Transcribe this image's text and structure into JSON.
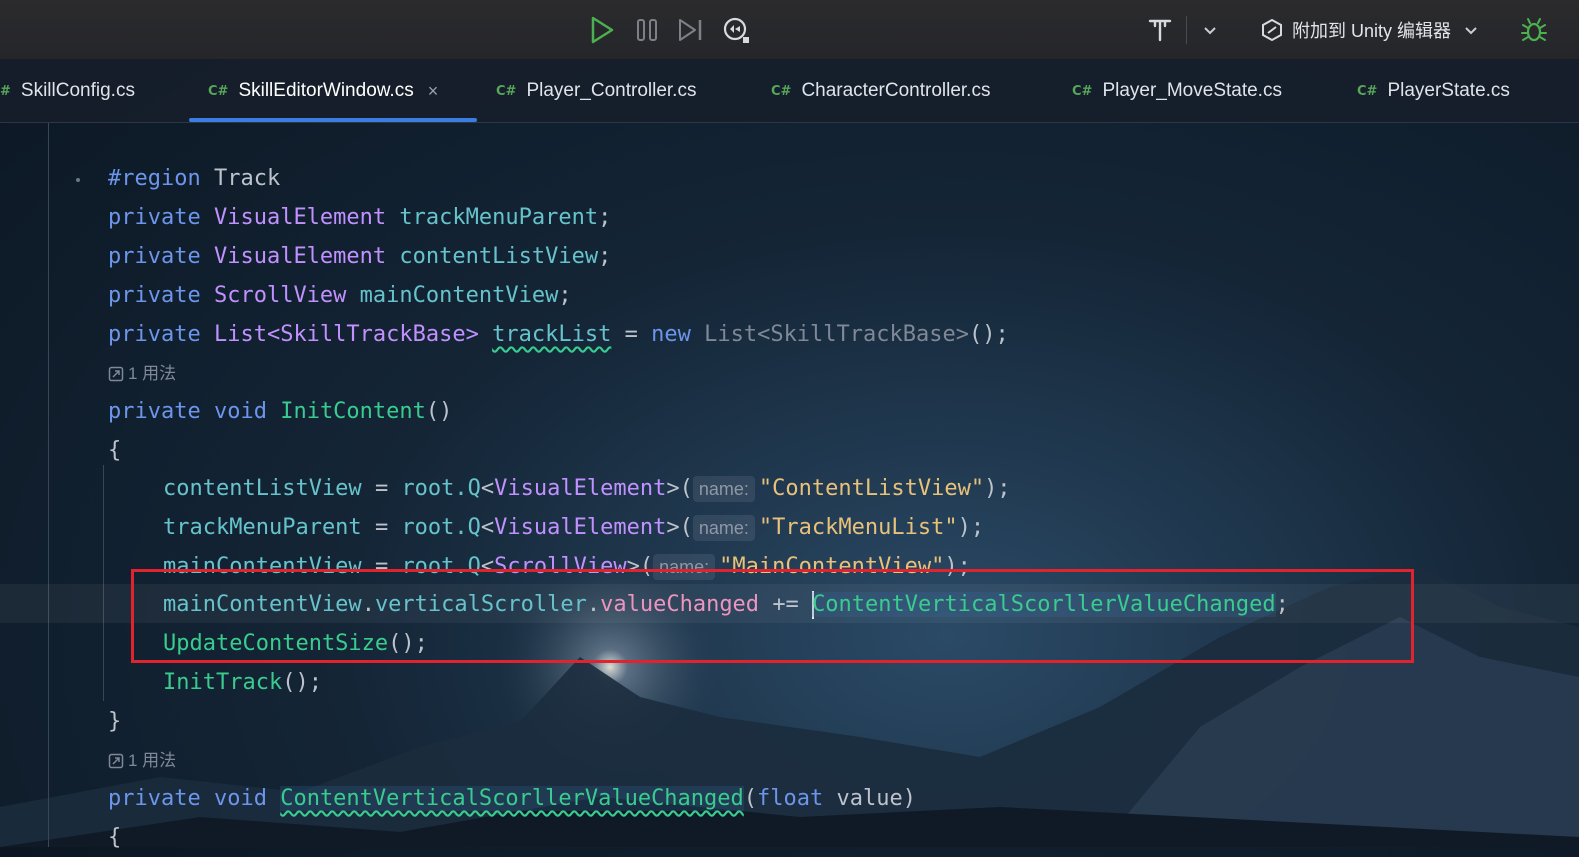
{
  "toolbar": {
    "attach_label": "附加到 Unity 编辑器",
    "colors": {
      "run": "#4caf50",
      "bug": "#4caf50"
    }
  },
  "tabs": [
    {
      "label": "SkillConfig.cs",
      "prefix": "#",
      "active": false
    },
    {
      "label": "SkillEditorWindow.cs",
      "prefix": "C#",
      "active": true
    },
    {
      "label": "Player_Controller.cs",
      "prefix": "C#",
      "active": false
    },
    {
      "label": "CharacterController.cs",
      "prefix": "C#",
      "active": false
    },
    {
      "label": "Player_MoveState.cs",
      "prefix": "C#",
      "active": false
    },
    {
      "label": "PlayerState.cs",
      "prefix": "C#",
      "active": false
    }
  ],
  "editor": {
    "usages": [
      "1 用法",
      "1 用法"
    ],
    "param_hint": "name:",
    "code": {
      "region_kw": "#region",
      "region_name": "Track",
      "private": "private",
      "void": "void",
      "new": "new",
      "float": "float",
      "visual_element": "VisualElement",
      "scroll_view": "ScrollView",
      "list_type": "List<SkillTrackBase>",
      "track_menu_parent": "trackMenuParent",
      "content_list_view": "contentListView",
      "main_content_view": "mainContentView",
      "track_list": "trackList",
      "init_content": "InitContent",
      "root_q": "root.Q",
      "str_content_list": "\"ContentListView\"",
      "str_track_menu": "\"TrackMenuList\"",
      "str_main_content": "\"MainContentView\"",
      "vertical_scroller": "verticalScroller",
      "value_changed": "valueChanged",
      "handler": "ContentVerticalScorllerValueChanged",
      "update_content_size": "UpdateContentSize",
      "init_track": "InitTrack",
      "value_param": "value"
    }
  }
}
